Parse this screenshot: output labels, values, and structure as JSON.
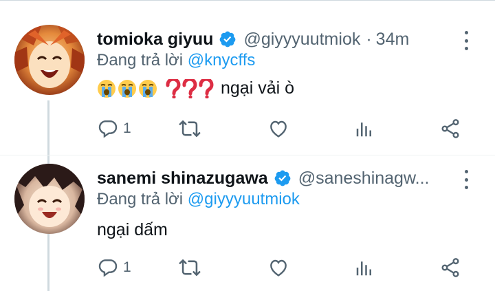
{
  "colors": {
    "accent": "#1d9bf0",
    "text": "#0f1419",
    "secondary": "#536471",
    "thread_line": "#cfd9de"
  },
  "tweets": [
    {
      "display_name": "tomioka giyuu",
      "verified_icon": "verified-badge-icon",
      "handle": "@giyyyuutmiok",
      "separator": "·",
      "time": "34m",
      "reply_prefix": "Đang trả lời",
      "reply_to": "@knycffs",
      "body_icons": [
        "loudly-crying-face-icon",
        "loudly-crying-face-icon",
        "loudly-crying-face-icon",
        "red-question-mark-icon",
        "red-question-mark-icon",
        "red-question-mark-icon"
      ],
      "body_text": "ngại vải ò",
      "reply_count": "1",
      "retweet_count": "",
      "like_count": ""
    },
    {
      "display_name": "sanemi shinazugawa",
      "verified_icon": "verified-badge-icon",
      "handle": "@saneshinagw...",
      "reply_prefix": "Đang trả lời",
      "reply_to": "@giyyyuutmiok",
      "body_text": "ngại dấm",
      "reply_count": "1",
      "retweet_count": "",
      "like_count": ""
    }
  ]
}
